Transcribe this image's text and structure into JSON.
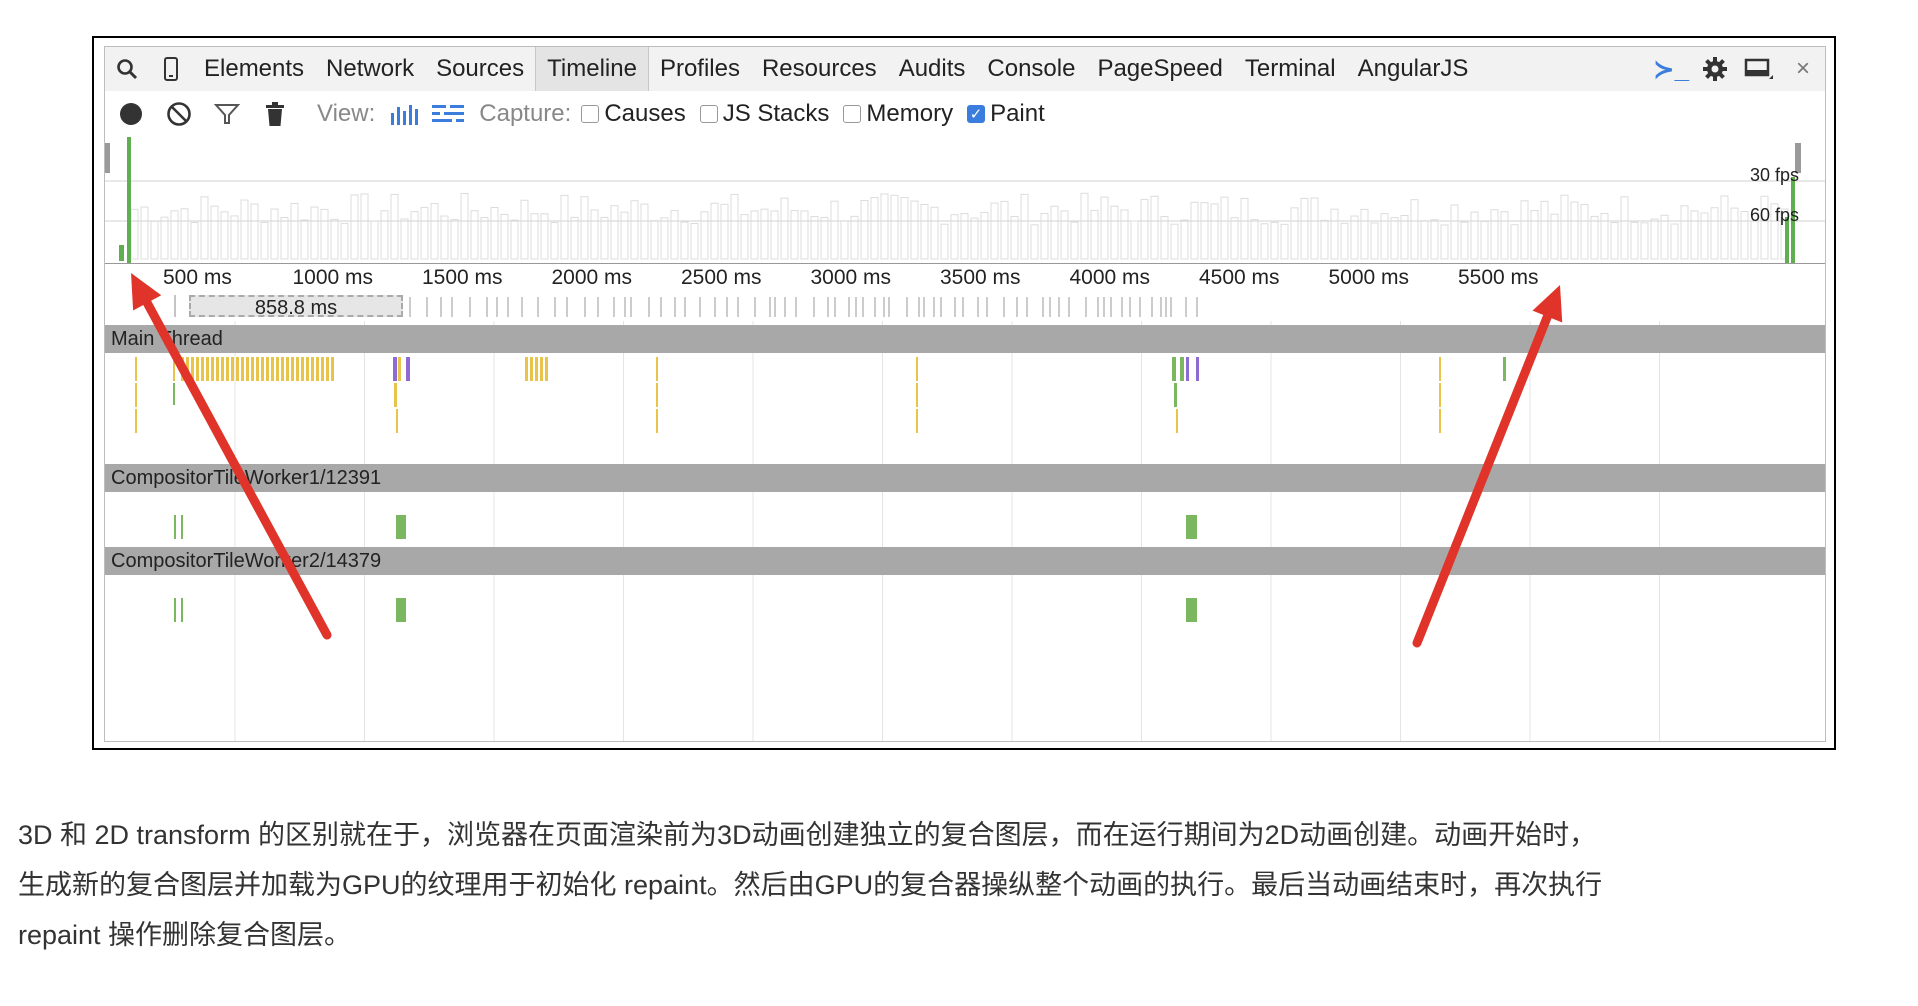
{
  "devtools": {
    "tabs": [
      "Elements",
      "Network",
      "Sources",
      "Timeline",
      "Profiles",
      "Resources",
      "Audits",
      "Console",
      "PageSpeed",
      "Terminal",
      "AngularJS"
    ],
    "active_tab": "Timeline",
    "icons": {
      "search": "search-icon",
      "device": "device-mode-icon",
      "console_drawer": "console-drawer-icon",
      "settings": "gear-icon",
      "dock": "dock-icon",
      "close": "close-icon"
    },
    "close_glyph": "×",
    "console_glyph": "≻_",
    "controls": {
      "view_label": "View:",
      "capture_label": "Capture:",
      "checkboxes": [
        {
          "label": "Causes",
          "checked": false
        },
        {
          "label": "JS Stacks",
          "checked": false
        },
        {
          "label": "Memory",
          "checked": false
        },
        {
          "label": "Paint",
          "checked": true
        }
      ]
    },
    "overview": {
      "fps_30": "30 fps",
      "fps_60": "60 fps"
    },
    "ruler_ticks": [
      "500 ms",
      "1000 ms",
      "1500 ms",
      "2000 ms",
      "2500 ms",
      "3000 ms",
      "3500 ms",
      "4000 ms",
      "4500 ms",
      "5000 ms",
      "5500 ms"
    ],
    "selection_duration": "858.8 ms",
    "threads": [
      "Main Thread",
      "CompositorTileWorker1/12391",
      "CompositorTileWorker2/14379"
    ],
    "colors": {
      "paint": "#7bb661",
      "script": "#e8c44a",
      "render": "#8e6bd3",
      "arrow": "#e0342a"
    }
  },
  "caption": {
    "line1": "3D 和 2D transform 的区别就在于，浏览器在页面渲染前为3D动画创建独立的复合图层，而在运行期间为2D动画创建。动画开始时，",
    "line2": "生成新的复合图层并加载为GPU的纹理用于初始化 repaint。然后由GPU的复合器操纵整个动画的执行。最后当动画结束时，再次执行",
    "line3": "repaint 操作删除复合图层。"
  }
}
